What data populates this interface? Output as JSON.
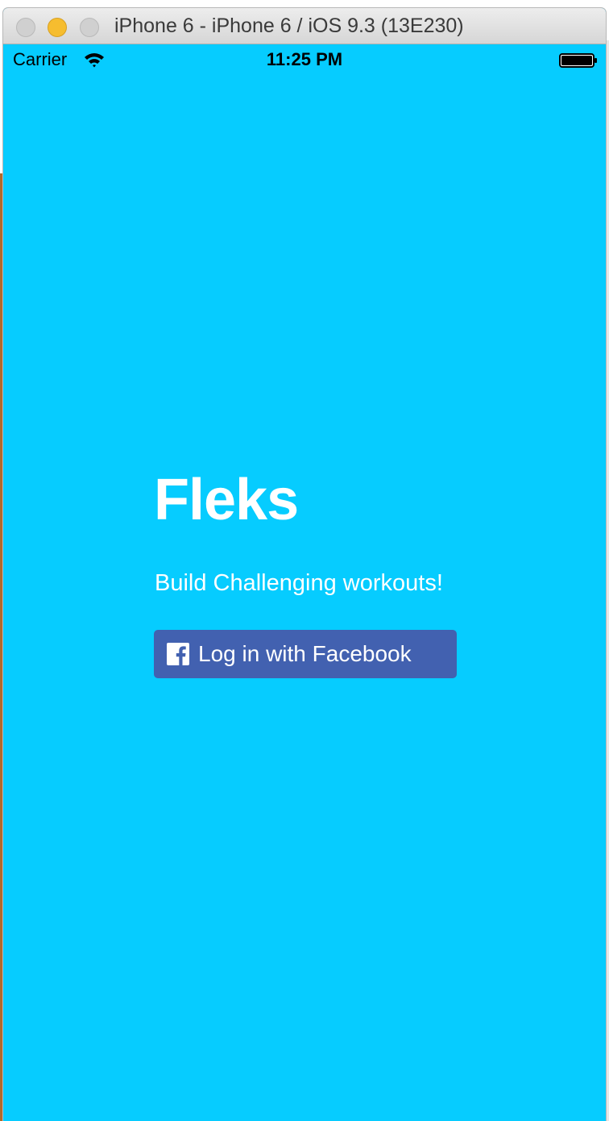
{
  "window": {
    "title": "iPhone 6 - iPhone 6 / iOS 9.3 (13E230)"
  },
  "status_bar": {
    "carrier": "Carrier",
    "time": "11:25 PM",
    "icons": [
      "wifi-icon",
      "battery-icon"
    ]
  },
  "app": {
    "title": "Fleks",
    "tagline": "Build Challenging workouts!",
    "login_button": {
      "label": "Log in with Facebook",
      "icon": "facebook-icon"
    }
  },
  "colors": {
    "background": "#06ccff",
    "facebook_button": "#4261b0",
    "text": "#ffffff",
    "traffic_minimize": "#f6bd2f"
  }
}
